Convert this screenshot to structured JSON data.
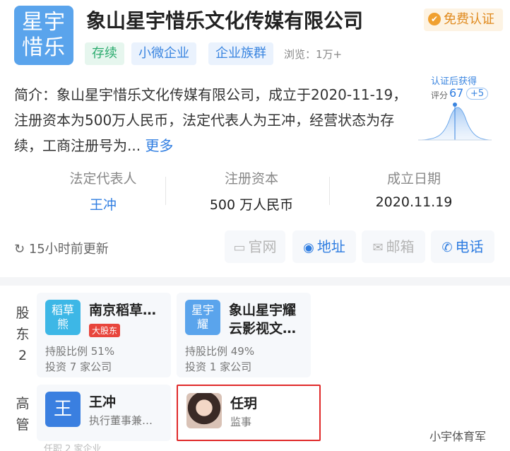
{
  "company": {
    "logo_line1": "星宇",
    "logo_line2": "惜乐",
    "name": "象山星宇惜乐文化传媒有限公司",
    "cert": "免费认证",
    "tags": [
      "存续",
      "小微企业",
      "企业族群"
    ],
    "views": "浏览：1万+"
  },
  "intro": {
    "text": "简介：象山星宇惜乐文化传媒有限公司，成立于2020-11-19，注册资本为500万人民币，法定代表人为王冲，经营状态为存续，工商注册号为...",
    "more": "更多"
  },
  "score": {
    "title": "认证后获得",
    "label": "评分",
    "value": "67",
    "plus": "+5",
    "level": 0.67
  },
  "info": {
    "legal_rep_label": "法定代表人",
    "legal_rep_value": "王冲",
    "capital_label": "注册资本",
    "capital_value": "500 万人民币",
    "founded_label": "成立日期",
    "founded_value": "2020.11.19"
  },
  "updated": "15小时前更新",
  "actions": {
    "website": "官网",
    "address": "地址",
    "email": "邮箱",
    "phone": "电话"
  },
  "shareholders": {
    "label_line1": "股",
    "label_line2": "东",
    "count": "2",
    "items": [
      {
        "avatar_line1": "稻草",
        "avatar_line2": "熊",
        "name": "南京稻草…",
        "badge": "大股东",
        "ratio": "持股比例 51%",
        "invest": "投资 7 家公司"
      },
      {
        "avatar_line1": "星宇",
        "avatar_line2": "耀",
        "name_line1": "象山星宇耀",
        "name_line2": "云影视文…",
        "ratio": "持股比例 49%",
        "invest": "投资 1 家公司"
      }
    ]
  },
  "managers": {
    "label_line1": "高",
    "label_line2": "管",
    "items": [
      {
        "avatar": "王",
        "name": "王冲",
        "role": "执行董事兼…",
        "partial": "任职 2 家企业"
      },
      {
        "name": "任玥",
        "role": "监事"
      }
    ]
  },
  "watermark": "小宇体育军"
}
